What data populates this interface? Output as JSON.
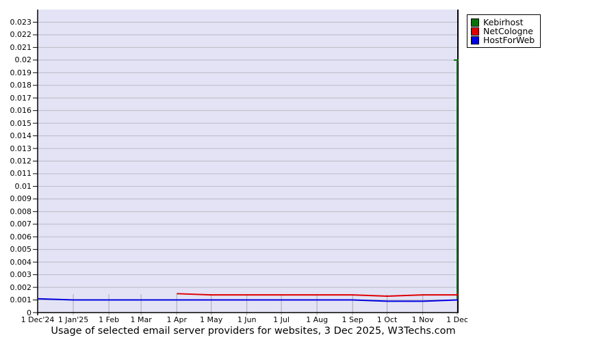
{
  "chart_data": {
    "type": "line",
    "title": "Usage of selected email server providers for websites, 3 Dec 2025, W3Techs.com",
    "x_tick_labels": [
      "1 Dec'24",
      "1 Jan'25",
      "1 Feb",
      "1 Mar",
      "1 Apr",
      "1 May",
      "1 Jun",
      "1 Jul",
      "1 Aug",
      "1 Sep",
      "1 Oct",
      "1 Nov",
      "1 Dec"
    ],
    "y_axis": {
      "min": 0,
      "max": 0.024,
      "tick_step": 0.001,
      "tick_labels": [
        "0",
        "0.001",
        "0.002",
        "0.003",
        "0.004",
        "0.005",
        "0.006",
        "0.007",
        "0.008",
        "0.009",
        "0.01",
        "0.011",
        "0.012",
        "0.013",
        "0.014",
        "0.015",
        "0.016",
        "0.017",
        "0.018",
        "0.019",
        "0.02",
        "0.021",
        "0.022",
        "0.023"
      ]
    },
    "series": [
      {
        "name": "Kebirhost",
        "color": "#077307",
        "values": [
          null,
          null,
          null,
          null,
          null,
          null,
          null,
          null,
          null,
          null,
          null,
          null,
          0.02
        ],
        "edge_spike": {
          "from": 0.001,
          "to": 0.02
        },
        "note": "appears only at final data point (3 Dec 2025), vertical spike at right edge"
      },
      {
        "name": "NetCologne",
        "color": "#dd0000",
        "values": [
          null,
          null,
          null,
          null,
          0.0015,
          0.0014,
          0.0014,
          0.0014,
          0.0014,
          0.0014,
          0.0013,
          0.0014,
          0.0014
        ],
        "end_value": 0.0015
      },
      {
        "name": "HostForWeb",
        "color": "#0000e0",
        "values": [
          0.0011,
          0.001,
          0.001,
          0.001,
          0.001,
          0.001,
          0.001,
          0.001,
          0.001,
          0.001,
          0.0009,
          0.0009,
          0.001
        ],
        "end_value": 0.001
      }
    ],
    "legend_position": "top-right",
    "grid": "horizontal-on",
    "plot_background": "#e3e3f5",
    "gridline_color": "#b9b9c4",
    "month_tick_color": "#a6a6b0",
    "axis_color": "#000000"
  }
}
